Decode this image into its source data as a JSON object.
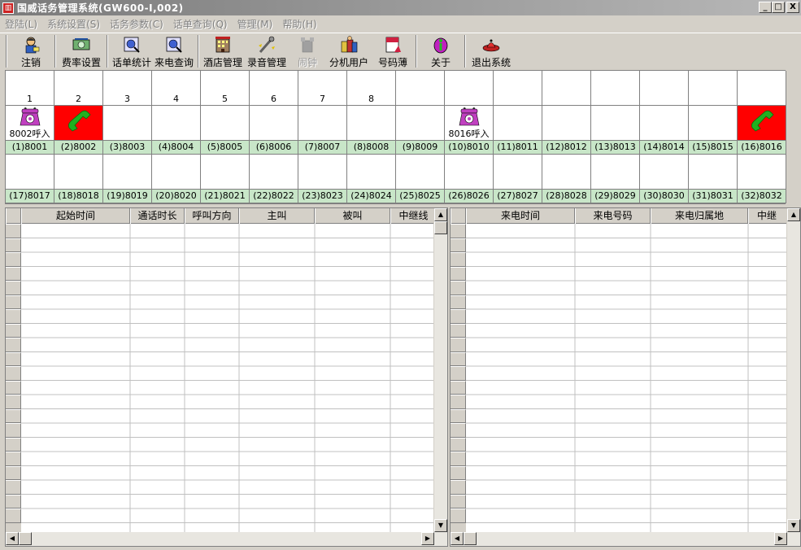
{
  "window": {
    "title": "国威话务管理系统(GW600-I,002)",
    "icon_glyph": "▥",
    "minimize": "_",
    "maximize": "□",
    "close": "X"
  },
  "menu": [
    "登陆(L)",
    "系统设置(S)",
    "话务参数(C)",
    "话单查询(Q)",
    "管理(M)",
    "帮助(H)"
  ],
  "toolbar": [
    {
      "label": "注销",
      "icon": "logout-icon",
      "disabled": false
    },
    {
      "label": "费率设置",
      "icon": "rate-icon",
      "disabled": false
    },
    {
      "label": "话单统计",
      "icon": "stats-icon",
      "disabled": false
    },
    {
      "label": "来电查询",
      "icon": "incoming-query-icon",
      "disabled": false
    },
    {
      "label": "酒店管理",
      "icon": "hotel-icon",
      "disabled": false
    },
    {
      "label": "录音管理",
      "icon": "recording-icon",
      "disabled": false
    },
    {
      "label": "闹钟",
      "icon": "alarm-icon",
      "disabled": true
    },
    {
      "label": "分机用户",
      "icon": "extension-users-icon",
      "disabled": false
    },
    {
      "label": "号码薄",
      "icon": "phonebook-icon",
      "disabled": false
    },
    {
      "label": "关于",
      "icon": "about-icon",
      "disabled": false
    },
    {
      "label": "退出系统",
      "icon": "exit-icon",
      "disabled": false
    }
  ],
  "trunks": [
    "1",
    "2",
    "3",
    "4",
    "5",
    "6",
    "7",
    "8",
    "",
    "",
    "",
    "",
    "",
    "",
    "",
    ""
  ],
  "trunk_active": [
    false,
    true,
    false,
    false,
    false,
    false,
    false,
    false,
    false,
    false,
    false,
    false,
    false,
    false,
    false,
    false
  ],
  "extensions_row1": [
    {
      "label": "(1)8001",
      "state": "ringing",
      "status": "8002呼入"
    },
    {
      "label": "(2)8002",
      "state": "offhook",
      "status": ""
    },
    {
      "label": "(3)8003",
      "state": "idle",
      "status": ""
    },
    {
      "label": "(4)8004",
      "state": "idle",
      "status": ""
    },
    {
      "label": "(5)8005",
      "state": "idle",
      "status": ""
    },
    {
      "label": "(6)8006",
      "state": "idle",
      "status": ""
    },
    {
      "label": "(7)8007",
      "state": "idle",
      "status": ""
    },
    {
      "label": "(8)8008",
      "state": "idle",
      "status": ""
    },
    {
      "label": "(9)8009",
      "state": "idle",
      "status": ""
    },
    {
      "label": "(10)8010",
      "state": "ringing",
      "status": "8016呼入"
    },
    {
      "label": "(11)8011",
      "state": "idle",
      "status": ""
    },
    {
      "label": "(12)8012",
      "state": "idle",
      "status": ""
    },
    {
      "label": "(13)8013",
      "state": "idle",
      "status": ""
    },
    {
      "label": "(14)8014",
      "state": "idle",
      "status": ""
    },
    {
      "label": "(15)8015",
      "state": "idle",
      "status": ""
    },
    {
      "label": "(16)8016",
      "state": "offhook",
      "status": ""
    }
  ],
  "extensions_row2": [
    {
      "label": "(17)8017"
    },
    {
      "label": "(18)8018"
    },
    {
      "label": "(19)8019"
    },
    {
      "label": "(20)8020"
    },
    {
      "label": "(21)8021"
    },
    {
      "label": "(22)8022"
    },
    {
      "label": "(23)8023"
    },
    {
      "label": "(24)8024"
    },
    {
      "label": "(25)8025"
    },
    {
      "label": "(26)8026"
    },
    {
      "label": "(27)8027"
    },
    {
      "label": "(28)8028"
    },
    {
      "label": "(29)8029"
    },
    {
      "label": "(30)8030"
    },
    {
      "label": "(31)8031"
    },
    {
      "label": "(32)8032"
    }
  ],
  "call_log_table": {
    "columns": [
      "起始时间",
      "通话时长",
      "呼叫方向",
      "主叫",
      "被叫",
      "中继线"
    ]
  },
  "incoming_table": {
    "columns": [
      "来电时间",
      "来电号码",
      "来电归属地",
      "中继"
    ]
  },
  "colors": {
    "active_cell": "#ff0000",
    "extension_label_bg": "#c8e6c8",
    "phone_purple": "#c040c0",
    "handset_green": "#20b020"
  }
}
